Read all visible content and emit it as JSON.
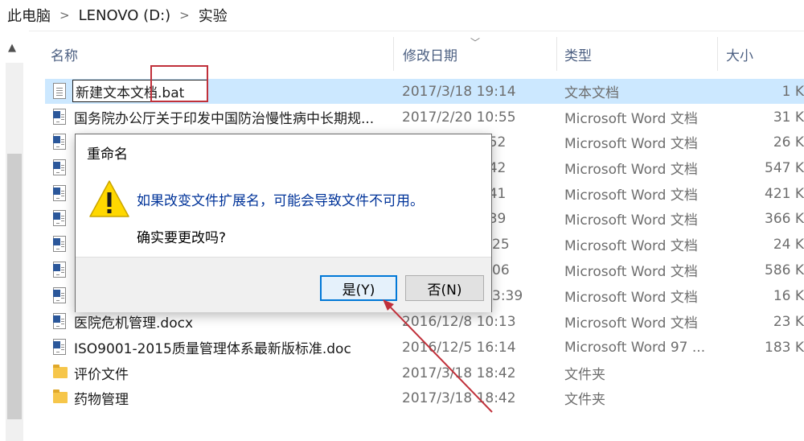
{
  "breadcrumb": [
    "此电脑",
    "LENOVO (D:)",
    "实验"
  ],
  "columns": {
    "name": "名称",
    "date": "修改日期",
    "type": "类型",
    "size": "大小"
  },
  "files": [
    {
      "name": "",
      "date": "2017/3/18 19:14",
      "type": "文本文档",
      "size": "1 K",
      "icon": "text-file-icon"
    },
    {
      "name": "国务院办公厅关于印发中国防治慢性病中长期规...",
      "date": "2017/2/20 10:55",
      "type": "Microsoft Word 文档",
      "size": "31 K",
      "icon": "word-file-icon"
    },
    {
      "name": "",
      "date": ":52",
      "type": "Microsoft Word 文档",
      "size": "26 K",
      "icon": "word-file-icon"
    },
    {
      "name": "",
      "date": ":42",
      "type": "Microsoft Word 文档",
      "size": "547 K",
      "icon": "word-file-icon"
    },
    {
      "name": "",
      "date": ":41",
      "type": "Microsoft Word 文档",
      "size": "421 K",
      "icon": "word-file-icon"
    },
    {
      "name": "",
      "date": ":39",
      "type": "Microsoft Word 文档",
      "size": "366 K",
      "icon": "word-file-icon"
    },
    {
      "name": "",
      "date": "25",
      "type": "Microsoft Word 文档",
      "size": "24 K",
      "icon": "word-file-icon"
    },
    {
      "name": "",
      "date": "06",
      "type": "Microsoft Word 文档",
      "size": "586 K",
      "icon": "word-file-icon"
    },
    {
      "name": "",
      "date": "3:39",
      "type": "Microsoft Word 文档",
      "size": "16 K",
      "icon": "word-file-icon"
    },
    {
      "name": "医院危机管理.docx",
      "date": "2016/12/8 10:13",
      "type": "Microsoft Word 文档",
      "size": "23 K",
      "icon": "word-file-icon"
    },
    {
      "name": "ISO9001-2015质量管理体系最新版标准.doc",
      "date": "2016/12/5 16:14",
      "type": "Microsoft Word 97 ...",
      "size": "183 K",
      "icon": "word-file-icon"
    },
    {
      "name": "评价文件",
      "date": "2017/3/18 18:42",
      "type": "文件夹",
      "size": "",
      "icon": "folder-icon"
    },
    {
      "name": "药物管理",
      "date": "2017/3/18 18:42",
      "type": "文件夹",
      "size": "",
      "icon": "folder-icon"
    }
  ],
  "rename_value": "新建文本文档.bat",
  "dialog": {
    "title": "重命名",
    "message": "如果改变文件扩展名，可能会导致文件不可用。",
    "confirm": "确实要更改吗?",
    "yes_label": "是(Y)",
    "no_label": "否(N)",
    "icon": "warning-icon"
  },
  "colors": {
    "selection": "#cce8ff",
    "accent": "#0078d7",
    "annotation": "#c0303a",
    "warning": "#ffd800"
  }
}
